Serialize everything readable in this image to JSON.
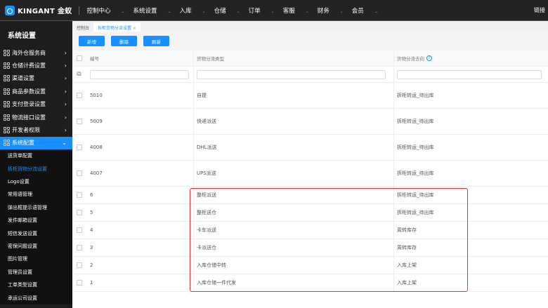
{
  "topbar": {
    "brand": "KINGANT 金蚁",
    "nav": [
      "控制中心",
      "系统设置",
      "入库",
      "仓储",
      "订单",
      "客服",
      "财务",
      "会员"
    ],
    "right": "链接"
  },
  "sidebar": {
    "title": "系统设置",
    "menu": [
      "海外仓服务商",
      "仓储计费设置",
      "渠道设置",
      "商品参数设置",
      "支付登录设置",
      "物流接口设置",
      "开发者权限"
    ],
    "active": "系统配置",
    "sub": [
      "送货单配置",
      "拆柜货物分流设置",
      "Logo设置",
      "常用语管理",
      "弹出框提示语管理",
      "发件邮箱设置",
      "短信发送设置",
      "密保问题设置",
      "图片管理",
      "管理员设置",
      "工单类型设置",
      "承运公司设置"
    ],
    "current": "拆柜货物分流设置"
  },
  "tabs": {
    "home": "控制台",
    "current": "拆柜货物分流设置",
    "close": "×"
  },
  "buttons": {
    "add": "新增",
    "delete": "删除",
    "refresh": "刷新"
  },
  "table": {
    "headers": [
      "编号",
      "货物分流类型",
      "货物分流去向"
    ],
    "rows": [
      {
        "id": "5010",
        "type": "自提",
        "dest": "拆柜转运_待出库"
      },
      {
        "id": "5009",
        "type": "快递派送",
        "dest": "拆柜转运_待出库"
      },
      {
        "id": "4008",
        "type": "DHL派送",
        "dest": "拆柜转运_待出库"
      },
      {
        "id": "4007",
        "type": "UPS派送",
        "dest": "拆柜转运_待出库"
      },
      {
        "id": "6",
        "type": "整柜派送",
        "dest": "拆柜转运_待出库"
      },
      {
        "id": "5",
        "type": "整柜送仓",
        "dest": "拆柜转运_待出库"
      },
      {
        "id": "4",
        "type": "卡车派送",
        "dest": "周转库存"
      },
      {
        "id": "3",
        "type": "卡派送仓",
        "dest": "周转库存"
      },
      {
        "id": "2",
        "type": "入库仓储中转",
        "dest": "入库上架"
      },
      {
        "id": "1",
        "type": "入库仓储一件代发",
        "dest": "入库上架"
      }
    ]
  },
  "colors": {
    "accent": "#1890ff",
    "highlight": "#e53935",
    "topbar": "#232323"
  }
}
